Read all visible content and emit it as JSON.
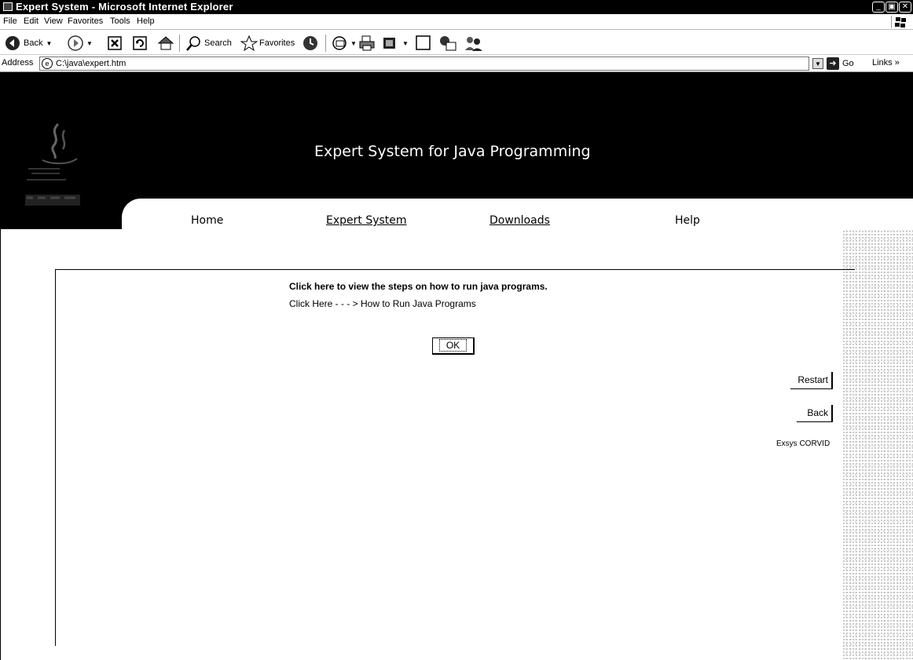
{
  "window": {
    "title": "Expert System - Microsoft Internet Explorer",
    "minimize": "_",
    "maximize": "▣",
    "close": "✕"
  },
  "menu": [
    "File",
    "Edit",
    "View",
    "Favorites",
    "Tools",
    "Help"
  ],
  "toolbar": {
    "back_label": "Back",
    "search_label": "Search",
    "favorites_label": "Favorites"
  },
  "address": {
    "label": "Address",
    "value": "C:\\java\\expert.htm",
    "go_label": "Go",
    "links_label": "Links »"
  },
  "site": {
    "title": "Expert System for Java Programming",
    "nav": [
      "Home",
      "Expert System",
      "Downloads",
      "Help"
    ]
  },
  "content": {
    "line1": "Click here to view the steps on how to run java programs.",
    "line2": "Click Here - - - > How to Run Java Programs",
    "ok_label": "OK",
    "restart_label": "Restart",
    "back_label": "Back",
    "engine": "Exsys CORVID"
  }
}
